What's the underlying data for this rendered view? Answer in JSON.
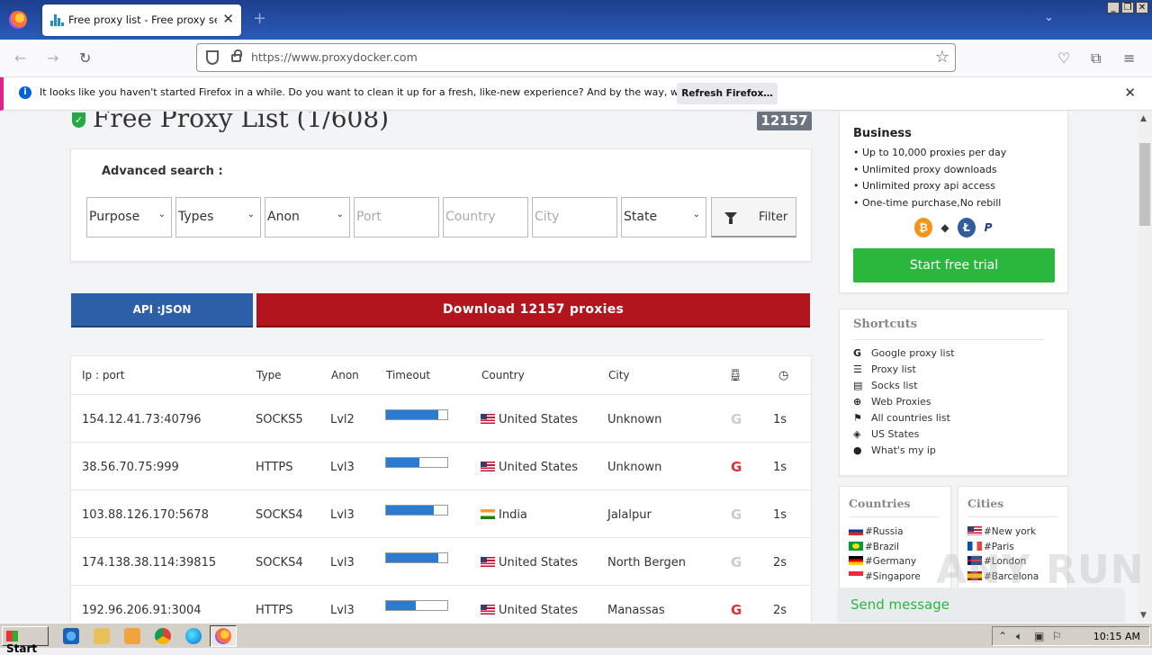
{
  "browser": {
    "tab_title": "Free proxy list - Free proxy server",
    "url": "https://www.proxydocker.com",
    "notification": "It looks like you haven't started Firefox in a while. Do you want to clean it up for a fresh, like-new experience? And by the way, welcome back!",
    "refresh_button": "Refresh Firefox…"
  },
  "page": {
    "title": "Free Proxy List (1/608)",
    "count_badge": "12157",
    "advanced_search_label": "Advanced search :",
    "filters": {
      "purpose": "Purpose",
      "types": "Types",
      "anon": "Anon",
      "port_placeholder": "Port",
      "country_placeholder": "Country",
      "city_placeholder": "City",
      "state": "State",
      "filter_button": "Filter"
    },
    "api_button": "API :JSON",
    "download_button": "Download 12157 proxies",
    "table": {
      "headers": [
        "Ip : port",
        "Type",
        "Anon",
        "Timeout",
        "Country",
        "City"
      ],
      "rows": [
        {
          "ip": "154.12.41.73:40796",
          "type": "SOCKS5",
          "anon": "Lvl2",
          "timeout": 0.85,
          "country": "United States",
          "flag": "us",
          "city": "Unknown",
          "google": false,
          "time": "1s"
        },
        {
          "ip": "38.56.70.75:999",
          "type": "HTTPS",
          "anon": "Lvl3",
          "timeout": 0.54,
          "country": "United States",
          "flag": "us",
          "city": "Unknown",
          "google": true,
          "time": "1s"
        },
        {
          "ip": "103.88.126.170:5678",
          "type": "SOCKS4",
          "anon": "Lvl3",
          "timeout": 0.78,
          "country": "India",
          "flag": "in",
          "city": "Jalalpur",
          "google": false,
          "time": "1s"
        },
        {
          "ip": "174.138.38.114:39815",
          "type": "SOCKS4",
          "anon": "Lvl3",
          "timeout": 0.86,
          "country": "United States",
          "flag": "us",
          "city": "North Bergen",
          "google": false,
          "time": "2s"
        },
        {
          "ip": "192.96.206.91:3004",
          "type": "HTTPS",
          "anon": "Lvl3",
          "timeout": 0.48,
          "country": "United States",
          "flag": "us",
          "city": "Manassas",
          "google": true,
          "time": "2s"
        }
      ]
    }
  },
  "sidebar": {
    "business": {
      "title": "Business",
      "features": [
        "Up to 10,000 proxies per day",
        "Unlimited proxy downloads",
        "Unlimited proxy api access",
        "One-time purchase,No rebill"
      ],
      "trial_button": "Start free trial"
    },
    "shortcuts": {
      "title": "Shortcuts",
      "items": [
        "Google proxy list",
        "Proxy list",
        "Socks list",
        "Web Proxies",
        "All countries list",
        "US States",
        "What's my ip"
      ]
    },
    "countries": {
      "title": "Countries",
      "items": [
        "#Russia",
        "#Brazil",
        "#Germany",
        "#Singapore"
      ]
    },
    "cities": {
      "title": "Cities",
      "items": [
        "#New york",
        "#Paris",
        "#London",
        "#Barcelona"
      ]
    },
    "send_message": "Send message"
  },
  "taskbar": {
    "start": "Start",
    "clock": "10:15 AM"
  },
  "watermark": "ANY RUN"
}
